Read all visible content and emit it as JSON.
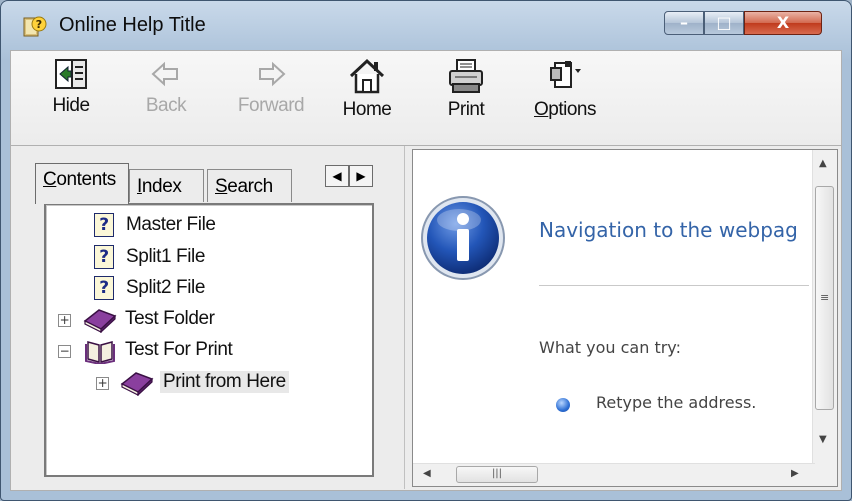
{
  "window": {
    "title": "Online Help Title",
    "controls": {
      "minimize": "–",
      "maximize": "□",
      "close": "X"
    }
  },
  "toolbar": {
    "buttons": [
      {
        "label": "Hide",
        "enabled": true,
        "icon": "hide-icon"
      },
      {
        "label": "Back",
        "enabled": false,
        "icon": "back-arrow-icon"
      },
      {
        "label": "Forward",
        "enabled": false,
        "icon": "forward-arrow-icon"
      },
      {
        "label": "Home",
        "enabled": true,
        "icon": "home-icon"
      },
      {
        "label": "Print",
        "enabled": true,
        "icon": "printer-icon"
      },
      {
        "label_u": "O",
        "label_rest": "ptions",
        "enabled": true,
        "icon": "options-icon"
      }
    ]
  },
  "tabs": [
    {
      "label_u": "C",
      "label_rest": "ontents",
      "active": true
    },
    {
      "label_u": "I",
      "label_rest": "ndex",
      "active": false
    },
    {
      "label_u": "S",
      "label_rest": "earch",
      "active": false
    }
  ],
  "tab_scroll": {
    "left": "◀",
    "right": "▶"
  },
  "tree": {
    "items": [
      {
        "label": "Master File",
        "icon": "help-topic-icon"
      },
      {
        "label": "Split1 File",
        "icon": "help-topic-icon"
      },
      {
        "label": "Split2 File",
        "icon": "help-topic-icon"
      },
      {
        "label": "Test Folder",
        "icon": "closed-book-icon",
        "expander": "+"
      },
      {
        "label": "Test For Print",
        "icon": "open-book-icon",
        "expander": "−"
      },
      {
        "label": "Print from Here",
        "icon": "closed-book-icon",
        "expander": "+",
        "selected": true
      }
    ],
    "topic_glyph": "?"
  },
  "content": {
    "heading": "Navigation to the webpag",
    "try_label": "What you can try:",
    "suggestion": "Retype the address."
  },
  "scrollbars": {
    "grip": "|||",
    "up": "▲",
    "down": "▼",
    "left": "◀",
    "right": "▶"
  },
  "colors": {
    "accent_link": "#3464a8",
    "book": "#6b2f7c",
    "info_blue": "#1f4da8"
  }
}
